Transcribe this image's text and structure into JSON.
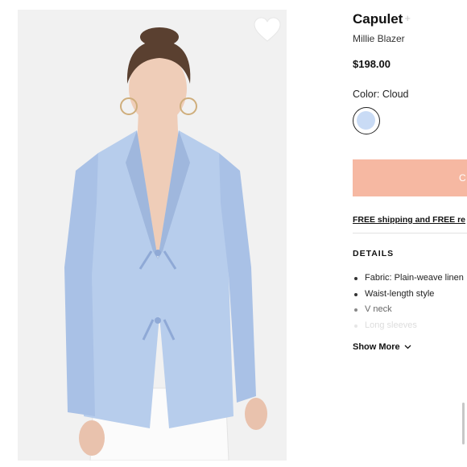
{
  "product": {
    "brand": "Capulet",
    "brand_plus": "+",
    "name": "Millie Blazer",
    "price": "$198.00",
    "color_label": "Color: Cloud",
    "swatch_color": "#c9dbf5",
    "add_to_bag_label": "C",
    "shipping_text": "FREE shipping and FREE re",
    "details_heading": "DETAILS",
    "details": [
      "Fabric: Plain-weave linen",
      "Waist-length style",
      "V neck",
      "Long sleeves"
    ],
    "show_more_label": "Show More"
  },
  "colors": {
    "accent_button": "#f6b8a2",
    "image_background": "#f1f1f1",
    "blazer": "#b7cdec"
  },
  "icons": {
    "favorite": "heart-icon",
    "expand": "chevron-down-icon"
  }
}
